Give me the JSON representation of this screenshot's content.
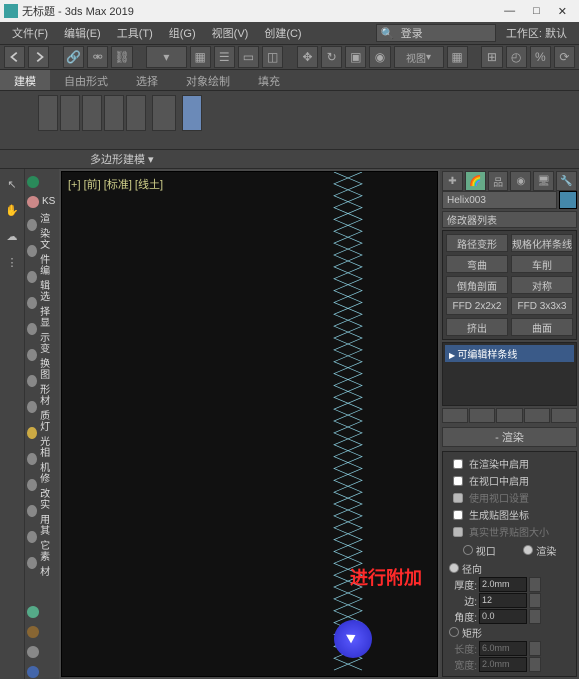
{
  "title": "无标题 - 3ds Max 2019",
  "menu": [
    "文件(F)",
    "编辑(E)",
    "工具(T)",
    "组(G)",
    "视图(V)",
    "创建(C)"
  ],
  "search_placeholder": "登录",
  "menu_right": [
    "工作区: 默认"
  ],
  "viewdd": "视图",
  "ribbon_tabs": [
    "建模",
    "自由形式",
    "选择",
    "对象绘制",
    "填充"
  ],
  "ribbon_label": "多边形建模 ▾",
  "viewport_label": "[+] [前] [标准] [线土]",
  "annotation": "进行附加",
  "side_items": [
    "KS",
    "渲染",
    "文件",
    "编辑",
    "选择",
    "显示",
    "变换",
    "图形",
    "材质",
    "灯光",
    "相机",
    "修改",
    "实用",
    "其它",
    "素材"
  ],
  "cmd": {
    "name": "Helix003",
    "modlist_label": "修改器列表",
    "mod_presets": [
      "路径变形",
      "规格化样条线",
      "弯曲",
      "车削",
      "倒角剖面",
      "对称",
      "FFD 2x2x2",
      "FFD 3x3x3",
      "挤出",
      "曲面"
    ],
    "stack_current": "可编辑样条线",
    "rollout_render_title": "渲染",
    "chk_render": "在渲染中启用",
    "chk_viewport": "在视口中启用",
    "chk_viewportopt": "使用视口设置",
    "chk_genmap": "生成贴图坐标",
    "chk_realworld": "真实世界贴图大小",
    "mode_viewport": "视口",
    "mode_render": "渲染",
    "radial": "径向",
    "thickness_label": "厚度:",
    "thickness_val": "2.0mm",
    "sides_label": "边:",
    "sides_val": "12",
    "angle_label": "角度:",
    "angle_val": "0.0",
    "rect": "矩形",
    "length_label": "长度:",
    "length_val": "6.0mm",
    "width_label": "宽度:",
    "width_val": "2.0mm"
  }
}
